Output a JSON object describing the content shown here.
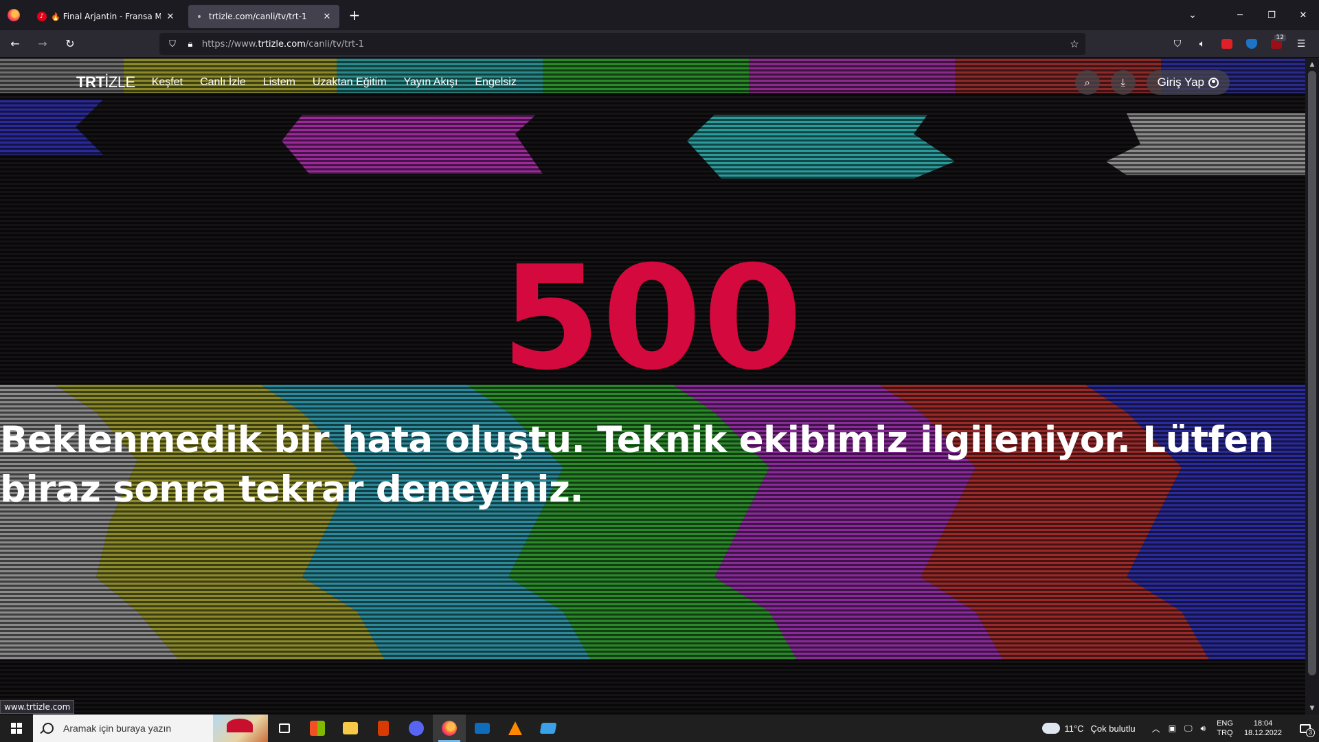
{
  "browser": {
    "tabs": [
      {
        "label": "Final Arjantin - Fransa Maç İ",
        "active": false
      },
      {
        "label": "trtizle.com/canli/tv/trt-1",
        "active": true
      }
    ],
    "url_prefix": "https://www.",
    "url_domain": "trtizle.com",
    "url_path": "/canli/tv/trt-1",
    "extension_badge": "12"
  },
  "site": {
    "logo_bold": "TRT",
    "logo_light": "İZLE",
    "nav": [
      "Keşfet",
      "Canlı İzle",
      "Listem",
      "Uzaktan Eğitim",
      "Yayın Akışı",
      "Engelsiz"
    ],
    "login_label": "Giriş Yap",
    "accent_color": "#d4093e"
  },
  "error": {
    "code": "500",
    "message": "Beklenmedik bir hata oluştu. Teknik ekibimiz ilgileniyor. Lütfen biraz sonra tekrar deneyiniz."
  },
  "status_link": "www.trtizle.com",
  "taskbar": {
    "search_placeholder": "Aramak için buraya yazın",
    "weather_temp": "11°C",
    "weather_condition": "Çok bulutlu",
    "lang_primary": "ENG",
    "lang_secondary": "TRQ",
    "time": "18:04",
    "date": "18.12.2022",
    "notification_count": "3"
  }
}
